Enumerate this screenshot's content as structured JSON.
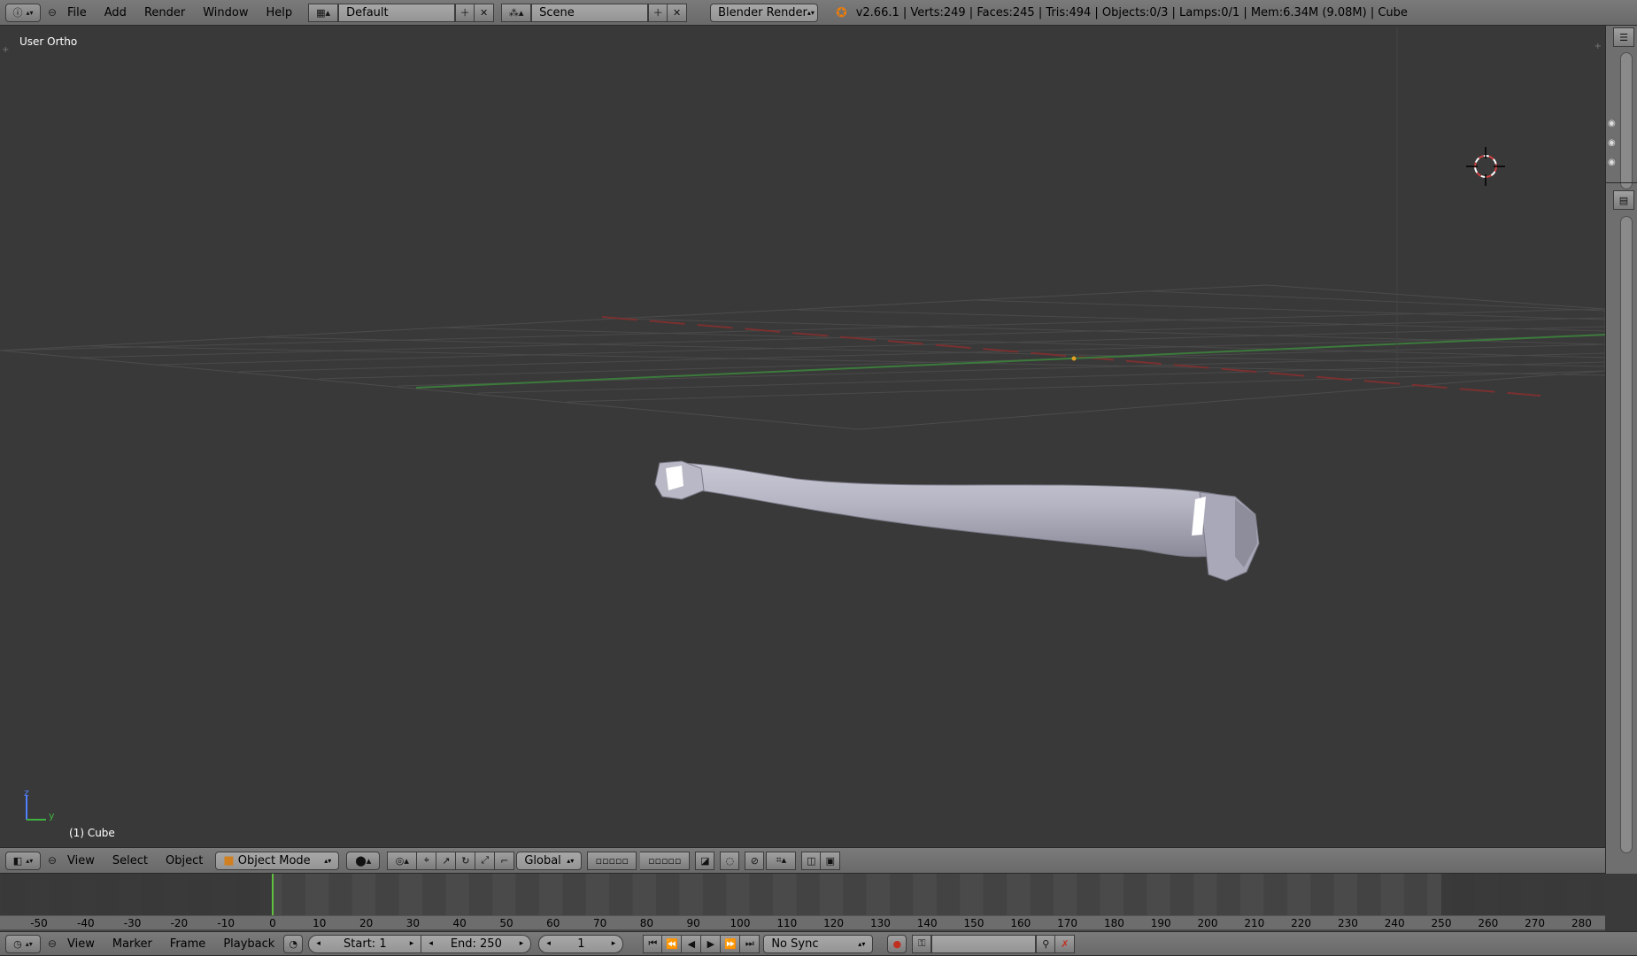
{
  "topbar": {
    "menus": [
      "File",
      "Add",
      "Render",
      "Window",
      "Help"
    ],
    "layout": "Default",
    "scene": "Scene",
    "render_engine": "Blender Render",
    "stats": "v2.66.1 | Verts:249 | Faces:245 | Tris:494 | Objects:0/3 | Lamps:0/1 | Mem:6.34M (9.08M) | Cube"
  },
  "viewport": {
    "view_name": "User Ortho",
    "object_name": "(1) Cube",
    "axis_z": "z",
    "axis_y": "y"
  },
  "vp_header": {
    "menus": [
      "View",
      "Select",
      "Object"
    ],
    "mode": "Object Mode",
    "orientation": "Global"
  },
  "timeline": {
    "ticks": [
      "-50",
      "-40",
      "-30",
      "-20",
      "-10",
      "0",
      "10",
      "20",
      "30",
      "40",
      "50",
      "60",
      "70",
      "80",
      "90",
      "100",
      "110",
      "120",
      "130",
      "140",
      "150",
      "160",
      "170",
      "180",
      "190",
      "200",
      "210",
      "220",
      "230",
      "240",
      "250",
      "260",
      "270",
      "280"
    ],
    "current_frame_value": 0
  },
  "tl_header": {
    "menus": [
      "View",
      "Marker",
      "Frame",
      "Playback"
    ],
    "start": "Start: 1",
    "end": "End: 250",
    "frame": "1",
    "sync": "No Sync"
  }
}
